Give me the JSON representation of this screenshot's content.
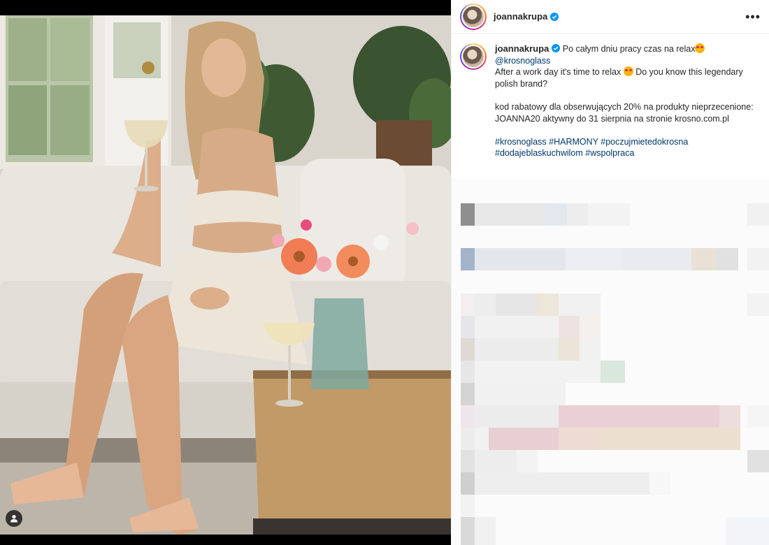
{
  "post": {
    "username": "joannakrupa",
    "more_icon": "more-horizontal-icon",
    "verified_icon": "verified-badge-icon"
  },
  "caption": {
    "username": "joannakrupa",
    "line1": "Po całym dniu pracy czas na relax",
    "mention": "@krosnoglass",
    "line2": "After a work day it's time to relax",
    "line2b": "Do you know this legendary polish brand?",
    "promo": "kod rabatowy dla obserwujących 20% na produkty nieprzecenione: JOANNA20 aktywny do 31 sierpnia na stronie krosno.com.pl",
    "hashtags": [
      "#krosnoglass",
      "#HARMONY",
      "#poczujmietedokrosna",
      "#dodajeblaskuchwilom",
      "#wspolpraca"
    ]
  },
  "media": {
    "tag_icon": "user-tag-icon"
  },
  "colors": {
    "link": "#00376b",
    "text": "#262626",
    "verified": "#0095f6"
  }
}
